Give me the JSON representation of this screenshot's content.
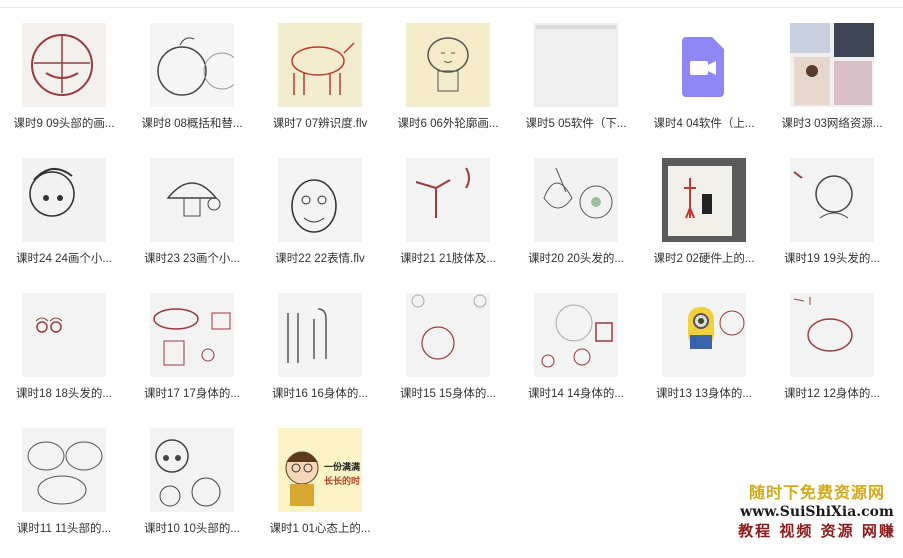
{
  "files": [
    {
      "label": "课时9 09头部的画...",
      "thumb": "head-sketch"
    },
    {
      "label": "课时8 08概括和替...",
      "thumb": "apple-sketch"
    },
    {
      "label": "课时7 07辨识度.flv",
      "thumb": "cow-sketch"
    },
    {
      "label": "课时6 06外轮廓画...",
      "thumb": "figure-sketch"
    },
    {
      "label": "课时5 05软件（下...",
      "thumb": "blank-software"
    },
    {
      "label": "课时4 04软件（上...",
      "thumb": "video-icon"
    },
    {
      "label": "课时3 03网络资源...",
      "thumb": "collage-photos"
    },
    {
      "label": "课时24 24画个小...",
      "thumb": "boy-sketch"
    },
    {
      "label": "课时23 23画个小...",
      "thumb": "mushroom-sketch"
    },
    {
      "label": "课时22 22表情.flv",
      "thumb": "face-sketch"
    },
    {
      "label": "课时21 21肢体及...",
      "thumb": "limb-sketch"
    },
    {
      "label": "课时20 20头发的...",
      "thumb": "hair-sketch"
    },
    {
      "label": "课时2 02硬件上的...",
      "thumb": "photo-board"
    },
    {
      "label": "课时19 19头发的...",
      "thumb": "alien-sketch"
    },
    {
      "label": "课时18 18头发的...",
      "thumb": "eyes-sketch"
    },
    {
      "label": "课时17 17身体的...",
      "thumb": "body-sketch"
    },
    {
      "label": "课时16 16身体的...",
      "thumb": "figures-sketch"
    },
    {
      "label": "课时15 15身体的...",
      "thumb": "circle-sketch"
    },
    {
      "label": "课时14 14身体的...",
      "thumb": "cups-sketch"
    },
    {
      "label": "课时13 13身体的...",
      "thumb": "minion-photo"
    },
    {
      "label": "课时12 12身体的...",
      "thumb": "oval-sketch"
    },
    {
      "label": "课时11 11头部的...",
      "thumb": "head-oval-sketch"
    },
    {
      "label": "课时10 10头部的...",
      "thumb": "girl-sketch"
    },
    {
      "label": "课时1 01心态上的...",
      "thumb": "cartoon-boy"
    }
  ],
  "watermark": {
    "line1": "随时下免费资源网",
    "line2": "www.SuiShiXia.com",
    "line3": "教程 视频 资源 网赚"
  },
  "colors": {
    "video_icon": "#8f87f5",
    "sketch_red": "#9b3b3b",
    "thumb_bg": "#eeeeee",
    "label_text": "#333333"
  }
}
